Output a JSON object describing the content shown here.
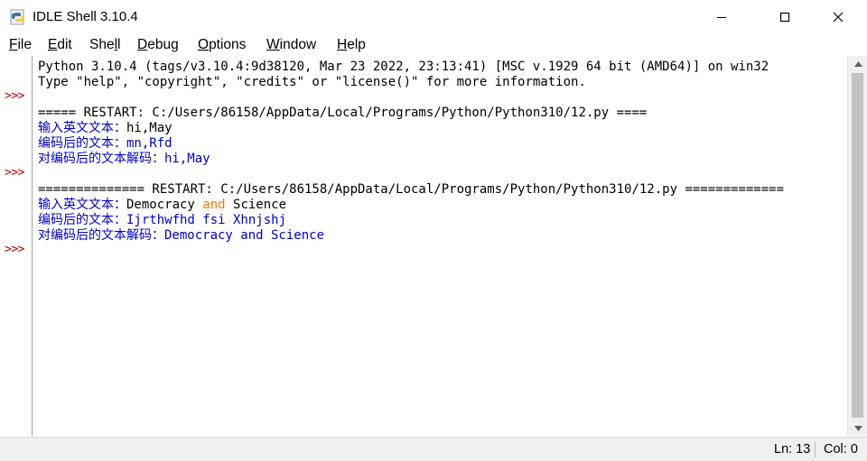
{
  "window": {
    "title": "IDLE Shell 3.10.4",
    "icon": "python-icon"
  },
  "menu": [
    {
      "label": "File",
      "mnemonic": "F",
      "rest": "ile"
    },
    {
      "label": "Edit",
      "mnemonic": "E",
      "rest": "dit"
    },
    {
      "label": "Shell",
      "pre": "She",
      "mnemonic": "l",
      "rest": "l"
    },
    {
      "label": "Debug",
      "mnemonic": "D",
      "rest": "ebug"
    },
    {
      "label": "Options",
      "mnemonic": "O",
      "rest": "ptions"
    },
    {
      "label": "Window",
      "mnemonic": "W",
      "rest": "indow"
    },
    {
      "label": "Help",
      "mnemonic": "H",
      "rest": "elp"
    }
  ],
  "shell": {
    "prompt": ">>>",
    "banner_line1": "Python 3.10.4 (tags/v3.10.4:9d38120, Mar 23 2022, 23:13:41) [MSC v.1929 64 bit (AMD64)] on win32",
    "banner_line2": "Type \"help\", \"copyright\", \"credits\" or \"license()\" for more information.",
    "restart1": "===== RESTART: C:/Users/86158/AppData/Local/Programs/Python/Python310/12.py ====",
    "run1_prompt": "输入英文文本：",
    "run1_input": "hi,May",
    "run1_encoded_label": "编码后的文本：",
    "run1_encoded": "mn,Rfd",
    "run1_decoded_label": "对编码后的文本解码：",
    "run1_decoded": "hi,May",
    "restart2": "============== RESTART: C:/Users/86158/AppData/Local/Programs/Python/Python310/12.py =============",
    "run2_prompt": "输入英文文本：",
    "run2_input_a": "Democracy ",
    "run2_input_kw": "and",
    "run2_input_b": " Science",
    "run2_encoded_label": "编码后的文本：",
    "run2_encoded": "Ijrthwfhd fsi Xhnjshj",
    "run2_decoded_label": "对编码后的文本解码：",
    "run2_decoded": "Democracy and Science"
  },
  "status": {
    "ln": "Ln: 13",
    "col": "Col: 0"
  },
  "colors": {
    "prompt": "#c00000",
    "output": "#0000c0",
    "keyword": "#ff7700"
  }
}
